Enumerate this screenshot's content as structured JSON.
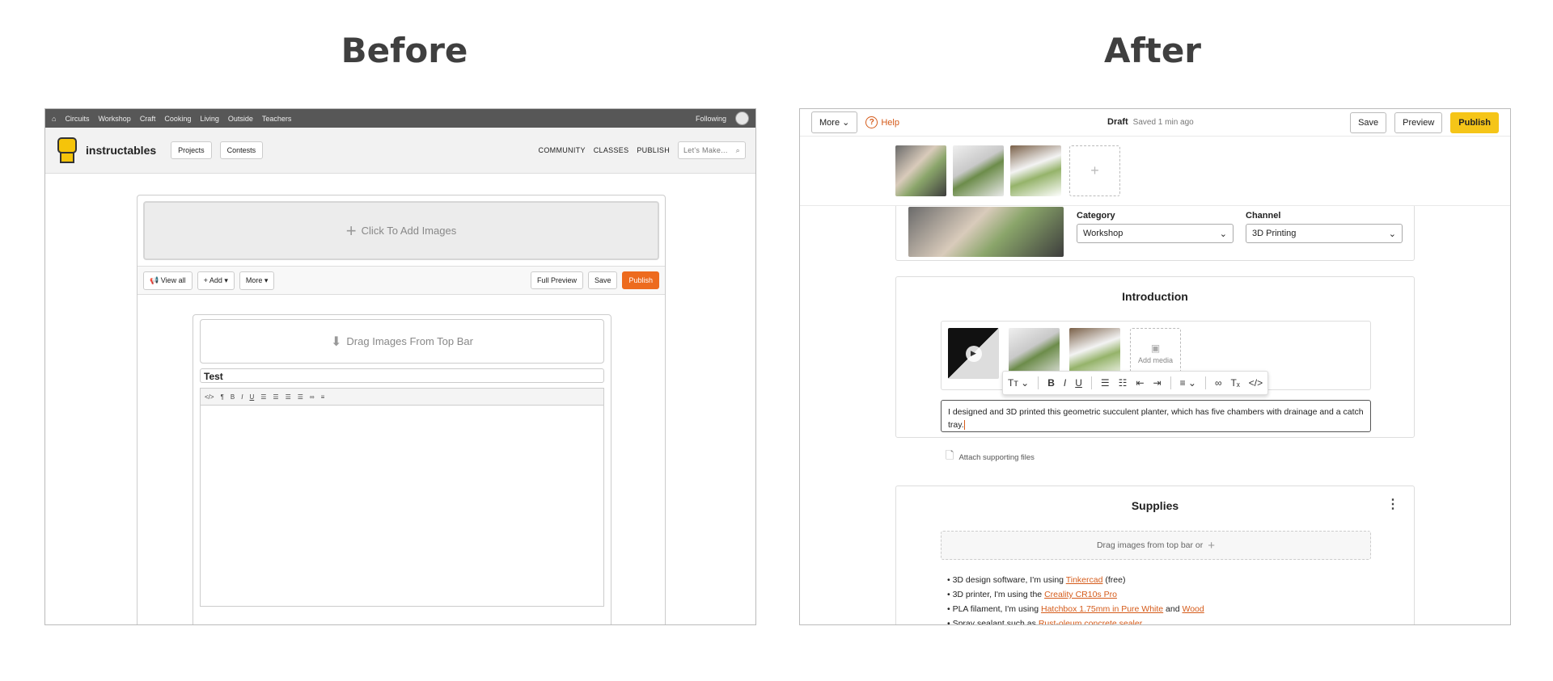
{
  "headings": {
    "before": "Before",
    "after": "After"
  },
  "before": {
    "topnav": {
      "items": [
        "Circuits",
        "Workshop",
        "Craft",
        "Cooking",
        "Living",
        "Outside",
        "Teachers"
      ],
      "following": "Following"
    },
    "header": {
      "logo": "instructables",
      "projects": "Projects",
      "contests": "Contests",
      "nav": [
        "COMMUNITY",
        "CLASSES",
        "PUBLISH"
      ],
      "search_placeholder": "Let's Make..."
    },
    "editor": {
      "add_images": "Click To Add Images",
      "toolbar": {
        "view_all": "View all",
        "add": "Add",
        "more": "More",
        "full_preview": "Full Preview",
        "save": "Save",
        "publish": "Publish"
      },
      "step": {
        "drag": "Drag Images From Top Bar",
        "title_value": "Test"
      }
    }
  },
  "after": {
    "topbar": {
      "more": "More",
      "help": "Help",
      "status": "Draft",
      "saved": "Saved 1 min ago",
      "save": "Save",
      "preview": "Preview",
      "publish": "Publish"
    },
    "category": {
      "label": "Category",
      "value": "Workshop"
    },
    "channel": {
      "label": "Channel",
      "value": "3D Printing"
    },
    "intro": {
      "title": "Introduction",
      "add_media": "Add media",
      "text": "I designed and 3D printed this geometric succulent planter, which has five chambers with drainage and a catch tray.",
      "attach": "Attach supporting files"
    },
    "supplies": {
      "title": "Supplies",
      "drag": "Drag images from top bar or",
      "items": [
        {
          "pre": "• 3D design software, I'm using ",
          "link": "Tinkercad",
          "post": " (free)"
        },
        {
          "pre": "• 3D printer, I'm using the ",
          "link": "Creality CR10s Pro",
          "post": ""
        },
        {
          "pre": "• PLA filament, I'm using ",
          "link": "Hatchbox 1.75mm in Pure White",
          "post": " and ",
          "link2": "Wood"
        },
        {
          "pre": "• Spray sealant such as ",
          "link": "Rust-oleum concrete sealer",
          "post": ""
        }
      ]
    }
  }
}
